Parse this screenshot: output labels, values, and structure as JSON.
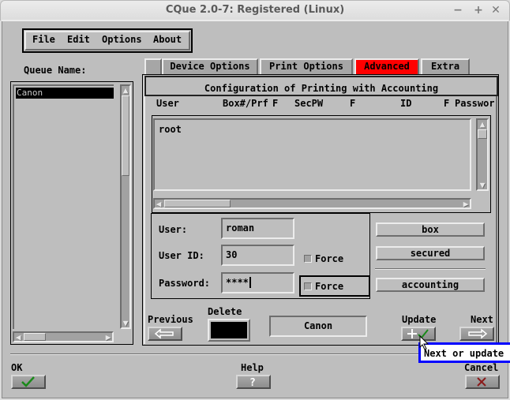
{
  "window": {
    "title": "CQue 2.0-7: Registered (Linux)",
    "controls": {
      "minimize": "−",
      "maximize": "+",
      "close": "✕"
    }
  },
  "menu": {
    "items": [
      {
        "label": "File"
      },
      {
        "label": "Edit"
      },
      {
        "label": "Options"
      },
      {
        "label": "About"
      }
    ]
  },
  "queue": {
    "label": "Queue Name:",
    "items": [
      "Canon"
    ],
    "selected": "Canon"
  },
  "tabs": [
    {
      "label": ""
    },
    {
      "label": "Device Options"
    },
    {
      "label": "Print Options"
    },
    {
      "label": "Advanced",
      "active": true
    },
    {
      "label": "Extra"
    }
  ],
  "advanced": {
    "section_title": "Configuration of Printing with Accounting",
    "columns": [
      "User",
      "Box#/Prf",
      "F",
      "SecPW",
      "F",
      "ID",
      "F",
      "Passwor"
    ],
    "rows": [
      "root"
    ],
    "form": {
      "user_label": "User:",
      "user_value": "roman",
      "userid_label": "User ID:",
      "userid_value": "30",
      "password_label": "Password:",
      "password_value": "****",
      "force_label_1": "Force",
      "force_label_2": "Force"
    },
    "buttons": {
      "box": "box",
      "secured": "secured",
      "accounting": "accounting"
    },
    "nav": {
      "previous_label": "Previous",
      "delete_label": "Delete",
      "queue_display": "Canon",
      "update_label": "Update",
      "next_label": "Next"
    }
  },
  "footer": {
    "ok_label": "OK",
    "help_label": "Help",
    "cancel_label": "Cancel"
  },
  "tooltip": {
    "text": "Next or update u"
  },
  "colors": {
    "active_tab": "#ff0000",
    "tooltip_border": "#0000ff",
    "ok_check": "#1a8a1a",
    "cancel_x": "#8a1a1a"
  }
}
